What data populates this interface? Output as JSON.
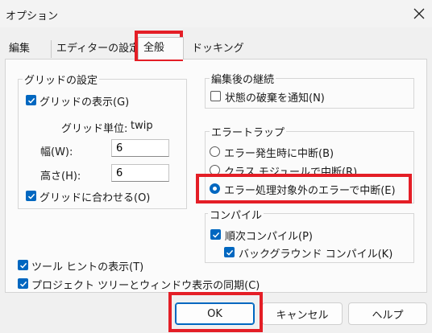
{
  "window": {
    "title": "オプション"
  },
  "tabs": [
    {
      "label": "編集"
    },
    {
      "label": "エディターの設定"
    },
    {
      "label": "全般"
    },
    {
      "label": "ドッキング"
    }
  ],
  "grid": {
    "legend": "グリッドの設定",
    "show_label": "グリッドの表示(G)",
    "show_checked": true,
    "unit_label": "グリッド単位:",
    "unit_value": "twip",
    "width_label": "幅(W):",
    "width_value": "6",
    "height_label": "高さ(H):",
    "height_value": "6",
    "align_label": "グリッドに合わせる(O)",
    "align_checked": true
  },
  "misc": {
    "tooltips_label": "ツール ヒントの表示(T)",
    "tooltips_checked": true,
    "sync_label": "プロジェクト ツリーとウィンドウ表示の同期(C)",
    "sync_checked": true
  },
  "edit_continue": {
    "legend": "編集後の継続",
    "notify_label": "状態の破棄を通知(N)",
    "notify_checked": false
  },
  "error_trap": {
    "legend": "エラートラップ",
    "options": [
      {
        "label": "エラー発生時に中断(B)",
        "selected": false
      },
      {
        "label": "クラス モジュールで中断(R)",
        "selected": false
      },
      {
        "label": "エラー処理対象外のエラーで中断(E)",
        "selected": true
      }
    ]
  },
  "compile": {
    "legend": "コンパイル",
    "ondemand_label": "順次コンパイル(P)",
    "ondemand_checked": true,
    "background_label": "バックグラウンド コンパイル(K)",
    "background_checked": true
  },
  "buttons": {
    "ok": "OK",
    "cancel": "キャンセル",
    "help": "ヘルプ"
  },
  "colors": {
    "accent": "#0067c0",
    "highlight": "#e41e26"
  }
}
